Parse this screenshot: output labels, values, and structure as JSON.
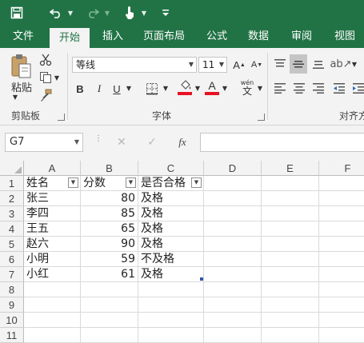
{
  "quick_access": {
    "save_icon": "save-icon",
    "undo_icon": "undo-icon",
    "redo_icon": "redo-icon",
    "touch_icon": "touch-mode-icon",
    "customize_icon": "customize-icon"
  },
  "tabs": [
    "文件",
    "开始",
    "插入",
    "页面布局",
    "公式",
    "数据",
    "审阅",
    "视图"
  ],
  "active_tab": "开始",
  "ribbon": {
    "clipboard": {
      "paste_label": "粘贴",
      "group_label": "剪贴板"
    },
    "font": {
      "font_name": "等线",
      "font_size": "11",
      "bold": "B",
      "italic": "I",
      "underline": "U",
      "wen_label": "wén",
      "group_label": "字体",
      "fill_color": "#e81123",
      "font_color": "#e81123"
    },
    "alignment": {
      "group_label": "对齐方"
    }
  },
  "formula_bar": {
    "name_box": "G7",
    "cancel": "✕",
    "enter": "✓",
    "fx": "fx",
    "value": ""
  },
  "columns": [
    "A",
    "B",
    "C",
    "D",
    "E",
    "F"
  ],
  "rows": [
    "1",
    "2",
    "3",
    "4",
    "5",
    "6",
    "7",
    "8",
    "9",
    "10",
    "11"
  ],
  "table": {
    "headers": [
      "姓名",
      "分数",
      "是否合格"
    ],
    "data": [
      [
        "张三",
        "80",
        "及格"
      ],
      [
        "李四",
        "85",
        "及格"
      ],
      [
        "王五",
        "65",
        "及格"
      ],
      [
        "赵六",
        "90",
        "及格"
      ],
      [
        "小明",
        "59",
        "不及格"
      ],
      [
        "小红",
        "61",
        "及格"
      ]
    ]
  },
  "colors": {
    "excel_green": "#217346",
    "ribbon_bg": "#f3f3f3",
    "red": "#e81123"
  }
}
